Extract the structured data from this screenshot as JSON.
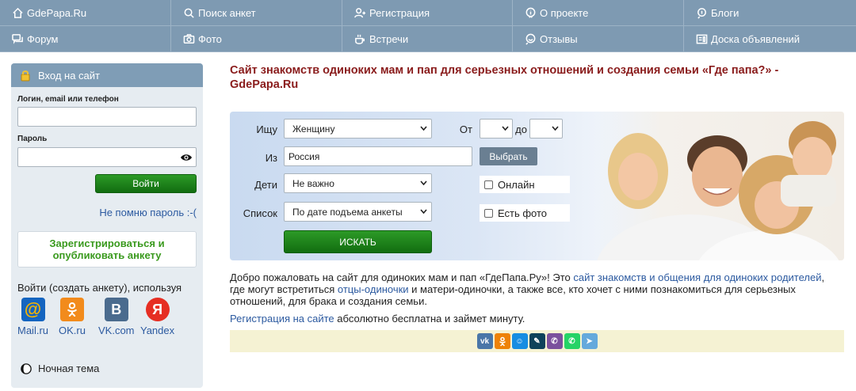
{
  "nav": {
    "row1": [
      {
        "label": "GdePapa.Ru",
        "icon": "home-icon"
      },
      {
        "label": "Поиск анкет",
        "icon": "search-icon"
      },
      {
        "label": "Регистрация",
        "icon": "add-user-icon"
      },
      {
        "label": "О проекте",
        "icon": "info-icon"
      },
      {
        "label": "Блоги",
        "icon": "blog-icon"
      }
    ],
    "row2": [
      {
        "label": "Форум",
        "icon": "forum-icon"
      },
      {
        "label": "Фото",
        "icon": "camera-icon"
      },
      {
        "label": "Встречи",
        "icon": "coffee-icon"
      },
      {
        "label": "Отзывы",
        "icon": "reviews-icon"
      },
      {
        "label": "Доска объявлений",
        "icon": "board-icon"
      }
    ]
  },
  "login": {
    "title": "Вход на сайт",
    "login_label": "Логин, email или телефон",
    "login_value": "",
    "password_label": "Пароль",
    "password_value": "",
    "submit": "Войти",
    "forgot": "Не помню пароль :-(",
    "register": "Зарегистрироваться и опубликовать анкету",
    "via": "Войти (создать анкету), используя",
    "providers": [
      {
        "name": "Mail.ru",
        "glyph": "@",
        "color": "#1565c0"
      },
      {
        "name": "OK.ru",
        "glyph": "ok",
        "color": "#f28b1c"
      },
      {
        "name": "VK.com",
        "glyph": "B",
        "color": "#4a6b8e"
      },
      {
        "name": "Yandex",
        "glyph": "Я",
        "color": "#e62e23"
      }
    ],
    "night_mode": "Ночная тема"
  },
  "main": {
    "title": "Сайт знакомств одиноких мам и пап для серьезных отношений и создания семьи «Где папа?» - GdePapa.Ru",
    "search": {
      "seek_label": "Ищу",
      "seek_value": "Женщину",
      "from_label": "От",
      "from_value": "",
      "to_label": "до",
      "to_value": "",
      "place_label": "Из",
      "place_value": "Россия",
      "choose_button": "Выбрать",
      "kids_label": "Дети",
      "kids_value": "Не важно",
      "online_label": "Онлайн",
      "list_label": "Список",
      "list_value": "По дате подъема анкеты",
      "photo_label": "Есть фото",
      "submit": "ИСКАТЬ"
    },
    "intro": {
      "p1_start": "Добро пожаловать на сайт для одиноких мам и пап «ГдеПапа.Ру»! Это ",
      "p1_link1": "сайт знакомств и общения для одиноких родителей",
      "p1_mid": ", где могут встретиться ",
      "p1_link2": "отцы-одиночки",
      "p1_end": " и матери-одиночки, а также все, кто хочет с ними познакомиться для серьезных отношений, для брака и создания семьи.",
      "reg_link": "Регистрация на сайте",
      "reg_rest": " абсолютно бесплатна и займет минуту."
    },
    "share": [
      {
        "name": "vk",
        "color": "#4a76a8",
        "glyph": "vk"
      },
      {
        "name": "ok",
        "color": "#ee8208",
        "glyph": "ok"
      },
      {
        "name": "moimir",
        "color": "#168de2",
        "glyph": "☺"
      },
      {
        "name": "livejournal",
        "color": "#0d425a",
        "glyph": "✎"
      },
      {
        "name": "viber",
        "color": "#7b519d",
        "glyph": "✆"
      },
      {
        "name": "whatsapp",
        "color": "#25d366",
        "glyph": "✆"
      },
      {
        "name": "telegram",
        "color": "#64a9dc",
        "glyph": "➤"
      }
    ]
  }
}
